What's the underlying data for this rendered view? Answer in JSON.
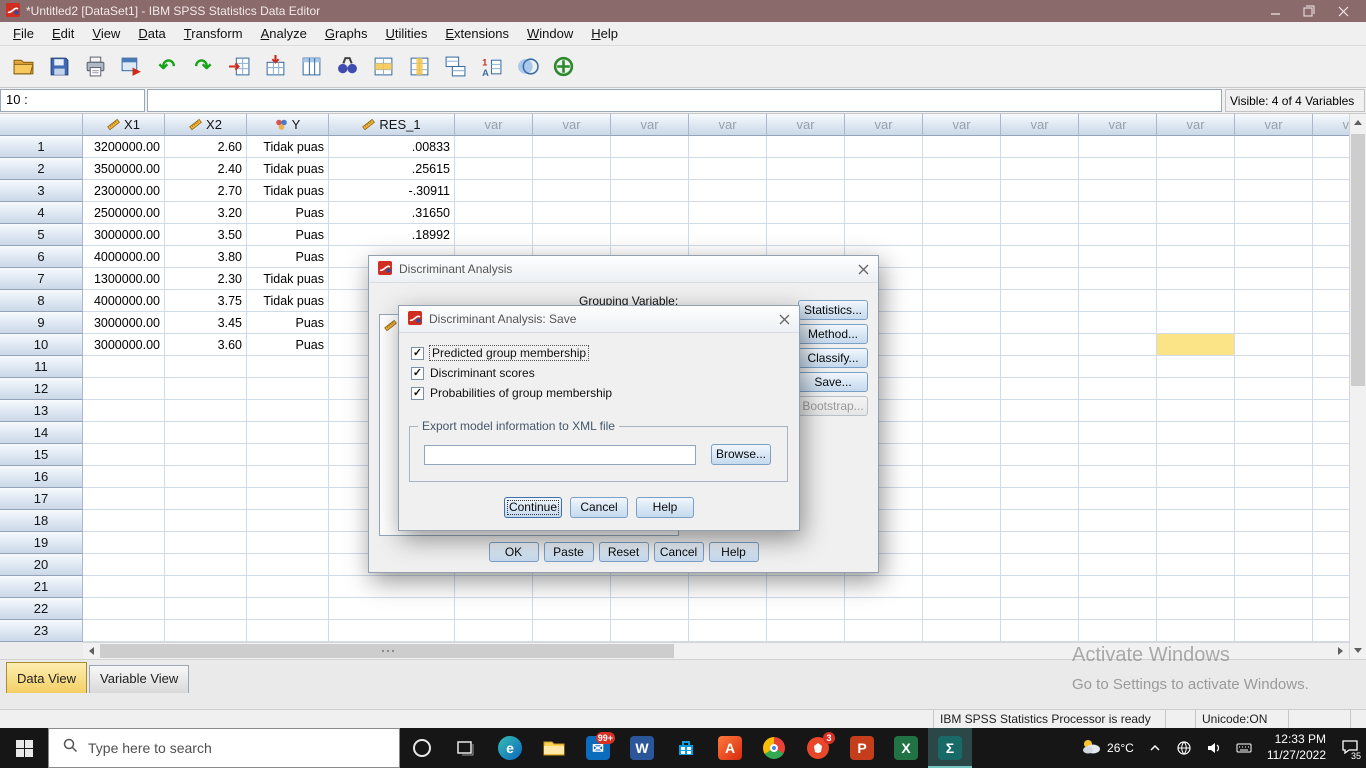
{
  "window": {
    "title": "*Untitled2 [DataSet1] - IBM SPSS Statistics Data Editor"
  },
  "menu": {
    "items": [
      "File",
      "Edit",
      "View",
      "Data",
      "Transform",
      "Analyze",
      "Graphs",
      "Utilities",
      "Extensions",
      "Window",
      "Help"
    ]
  },
  "toolbar": {
    "icons": [
      "open-data",
      "save",
      "print",
      "recall-dialogs",
      "undo",
      "redo",
      "goto-case",
      "goto-variable",
      "variables",
      "find",
      "insert-cases",
      "insert-variables",
      "split-file",
      "value-labels",
      "use-variable-sets",
      "show-all-variables"
    ]
  },
  "cellref": {
    "row_label": "10 :",
    "editor_value": "",
    "visible_info": "Visible: 4 of 4 Variables"
  },
  "grid": {
    "columns": [
      {
        "label": "X1",
        "measure": "scale"
      },
      {
        "label": "X2",
        "measure": "scale"
      },
      {
        "label": "Y",
        "measure": "nominal"
      },
      {
        "label": "RES_1",
        "measure": "scale"
      }
    ],
    "var_label": "var",
    "var_columns": 12,
    "total_rows": 23,
    "selected_cell": {
      "row": 10,
      "var_index": 10
    },
    "rows": [
      {
        "n": "1",
        "x1": "3200000.00",
        "x2": "2.60",
        "y": "Tidak puas",
        "res": ".00833"
      },
      {
        "n": "2",
        "x1": "3500000.00",
        "x2": "2.40",
        "y": "Tidak puas",
        "res": ".25615"
      },
      {
        "n": "3",
        "x1": "2300000.00",
        "x2": "2.70",
        "y": "Tidak puas",
        "res": "-.30911"
      },
      {
        "n": "4",
        "x1": "2500000.00",
        "x2": "3.20",
        "y": "Puas",
        "res": ".31650"
      },
      {
        "n": "5",
        "x1": "3000000.00",
        "x2": "3.50",
        "y": "Puas",
        "res": ".18992"
      },
      {
        "n": "6",
        "x1": "4000000.00",
        "x2": "3.80",
        "y": "Puas",
        "res": ""
      },
      {
        "n": "7",
        "x1": "1300000.00",
        "x2": "2.30",
        "y": "Tidak puas",
        "res": ""
      },
      {
        "n": "8",
        "x1": "4000000.00",
        "x2": "3.75",
        "y": "Tidak puas",
        "res": ""
      },
      {
        "n": "9",
        "x1": "3000000.00",
        "x2": "3.45",
        "y": "Puas",
        "res": ""
      },
      {
        "n": "10",
        "x1": "3000000.00",
        "x2": "3.60",
        "y": "Puas",
        "res": ""
      }
    ]
  },
  "dialog_back": {
    "title": "Discriminant Analysis",
    "grouping_label": "Grouping Variable:",
    "side_buttons": [
      {
        "label": "Statistics...",
        "enabled": true
      },
      {
        "label": "Method...",
        "enabled": true
      },
      {
        "label": "Classify...",
        "enabled": true
      },
      {
        "label": "Save...",
        "enabled": true
      },
      {
        "label": "Bootstrap...",
        "enabled": false
      }
    ],
    "bottom_buttons": [
      "OK",
      "Paste",
      "Reset",
      "Cancel",
      "Help"
    ]
  },
  "dialog_save": {
    "title": "Discriminant Analysis: Save",
    "checkboxes": [
      {
        "label": "Predicted group membership",
        "checked": true,
        "focused": true
      },
      {
        "label": "Discriminant scores",
        "checked": true,
        "focused": false
      },
      {
        "label": "Probabilities of group membership",
        "checked": true,
        "focused": false
      }
    ],
    "export_group_label": "Export model information to XML file",
    "xml_field_value": "",
    "browse_label": "Browse...",
    "buttons": [
      {
        "label": "Continue",
        "focused": true
      },
      {
        "label": "Cancel",
        "focused": false
      },
      {
        "label": "Help",
        "focused": false
      }
    ]
  },
  "tabs": {
    "data_view": "Data View",
    "variable_view": "Variable View"
  },
  "statusbar": {
    "message": "IBM SPSS Statistics Processor is ready",
    "unicode": "Unicode:ON"
  },
  "watermark": {
    "line1": "Activate Windows",
    "line2": "Go to Settings to activate Windows."
  },
  "taskbar": {
    "search_placeholder": "Type here to search",
    "pinned": [
      "cortana",
      "task-view",
      "edge",
      "file-explorer",
      "mail",
      "word",
      "store",
      "adobe",
      "chrome",
      "brave",
      "powerpoint",
      "excel",
      "spss"
    ],
    "badges": {
      "mail": "99+",
      "brave": "3"
    },
    "active": "spss",
    "weather": "26°C",
    "time": "12:33 PM",
    "date": "11/27/2022",
    "notification_count": "35"
  }
}
